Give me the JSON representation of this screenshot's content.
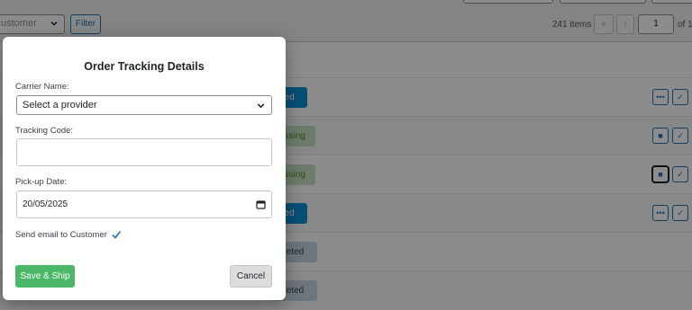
{
  "filters": {
    "customer_placeholder": "ustomer",
    "filter_label": "Filter"
  },
  "pagination": {
    "items_count": "241 items",
    "first_label": "«",
    "prev_label": "‹",
    "current_page": "1",
    "of_label": "of 1"
  },
  "orders": [
    {
      "status": "ped"
    },
    {
      "status": "essing"
    },
    {
      "status": "essing"
    },
    {
      "status": "ped"
    },
    {
      "status": "pleted"
    },
    {
      "status": "pleted"
    }
  ],
  "row_actions": {
    "more_glyph": "•••",
    "check_glyph": "✓",
    "ship_glyph": "■"
  },
  "modal": {
    "title": "Order Tracking Details",
    "carrier_label": "Carrier Name:",
    "carrier_value": "Select a provider",
    "tracking_label": "Tracking Code:",
    "tracking_value": "",
    "pickup_label": "Pick-up Date:",
    "pickup_value": "20/05/2025",
    "send_email_label": "Send email to Customer",
    "send_email_checked": true,
    "save_label": "Save & Ship",
    "cancel_label": "Cancel"
  },
  "colors": {
    "overlay": "rgba(0,0,0,0.45)",
    "accent": "#2271b1",
    "save_button": "#4ab866",
    "shipped": "#0e8fd6",
    "processing": "#c6e1c6",
    "completed": "#c8d7e1"
  },
  "icons": [
    "chevron-down-icon",
    "calendar-icon",
    "checkbox-checked-icon",
    "more-icon",
    "check-icon",
    "ship-icon"
  ]
}
